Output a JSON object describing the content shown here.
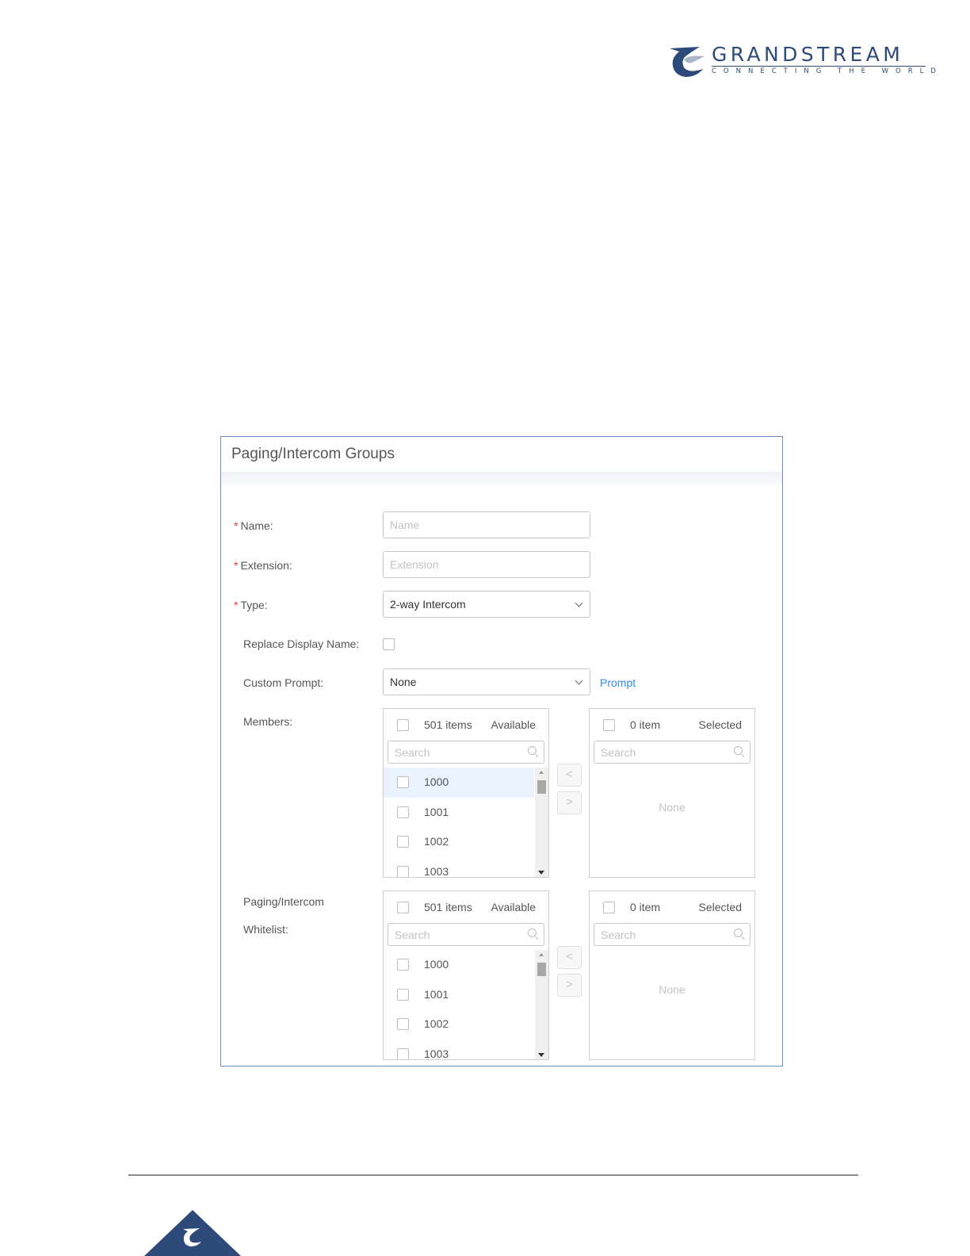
{
  "header": {
    "brand": "GRANDSTREAM",
    "tagline": "CONNECTING THE WORLD"
  },
  "dialog": {
    "title": "Paging/Intercom Groups",
    "fields": {
      "name": {
        "label": "Name:",
        "placeholder": "Name",
        "required": true
      },
      "extension": {
        "label": "Extension:",
        "placeholder": "Extension",
        "required": true
      },
      "type": {
        "label": "Type:",
        "value": "2-way Intercom",
        "required": true
      },
      "replace_display_name": {
        "label": "Replace Display Name:",
        "checked": false
      },
      "custom_prompt": {
        "label": "Custom Prompt:",
        "value": "None",
        "link": "Prompt"
      },
      "members": {
        "label": "Members:",
        "available": {
          "count": "501 items",
          "title": "Available",
          "search": "Search",
          "items": [
            "1000",
            "1001",
            "1002",
            "1003"
          ]
        },
        "selected": {
          "count": "0 item",
          "title": "Selected",
          "search": "Search",
          "empty": "None"
        }
      },
      "whitelist": {
        "label_line1": "Paging/Intercom",
        "label_line2": "Whitelist:",
        "available": {
          "count": "501 items",
          "title": "Available",
          "search": "Search",
          "items": [
            "1000",
            "1001",
            "1002",
            "1003"
          ]
        },
        "selected": {
          "count": "0 item",
          "title": "Selected",
          "search": "Search",
          "empty": "None"
        }
      }
    },
    "buttons": {
      "move_left": "<",
      "move_right": ">"
    }
  },
  "colors": {
    "brand": "#2e4a7a",
    "required": "#e03a3a",
    "link": "#2d8cf0",
    "dialog_border": "#6a8fc6",
    "highlight": "#eaf3fd"
  }
}
